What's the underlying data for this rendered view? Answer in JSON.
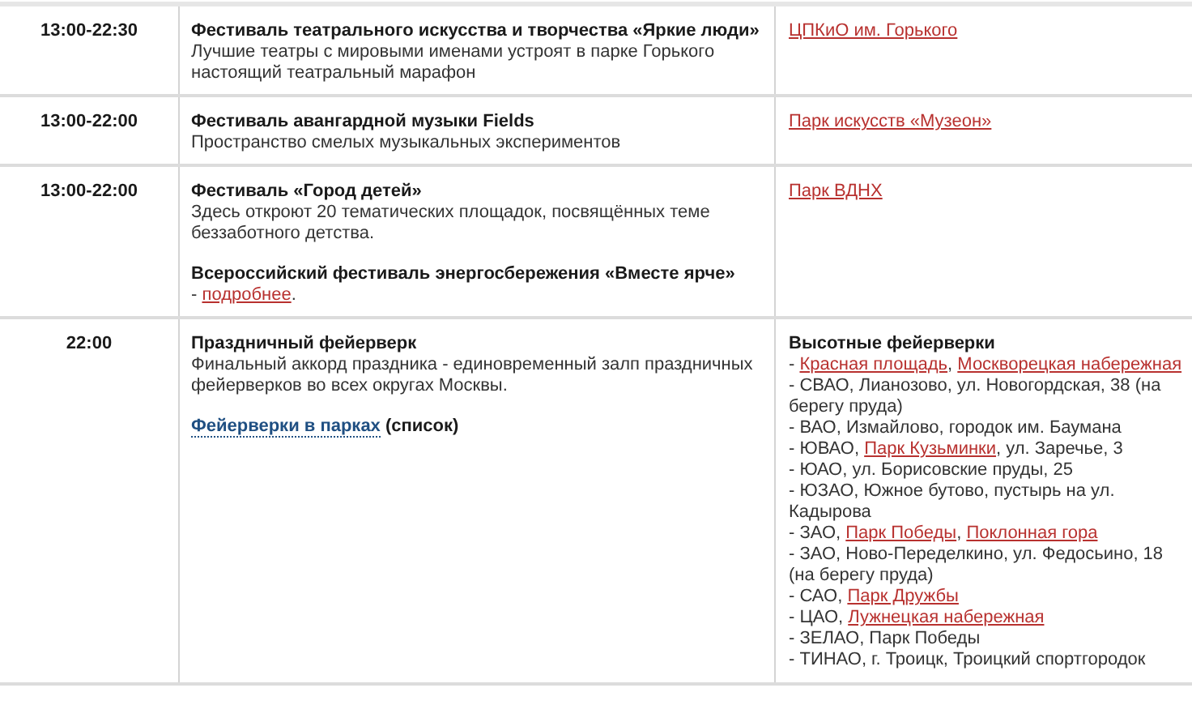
{
  "rows": [
    {
      "time": "13:00-22:30",
      "event": [
        {
          "kind": "title",
          "segments": [
            {
              "kind": "text",
              "text": "Фестиваль театрального искусства и творчества «Яркие люди»"
            }
          ]
        },
        {
          "kind": "text",
          "segments": [
            {
              "kind": "text",
              "text": "Лучшие театры с мировыми именами устроят в парке Горького настоящий театральный марафон"
            }
          ]
        }
      ],
      "place": [
        {
          "kind": "text",
          "segments": [
            {
              "kind": "link",
              "text": "ЦПКиО им. Горького"
            }
          ]
        }
      ]
    },
    {
      "time": "13:00-22:00",
      "event": [
        {
          "kind": "title",
          "segments": [
            {
              "kind": "text",
              "text": "Фестиваль авангардной музыки Fields"
            }
          ]
        },
        {
          "kind": "text",
          "segments": [
            {
              "kind": "text",
              "text": "Пространство смелых музыкальных экспериментов"
            }
          ]
        }
      ],
      "place": [
        {
          "kind": "text",
          "segments": [
            {
              "kind": "link",
              "text": "Парк искусств «Музеон»"
            }
          ]
        }
      ]
    },
    {
      "time": "13:00-22:00",
      "event": [
        {
          "kind": "title",
          "segments": [
            {
              "kind": "text",
              "text": "Фестиваль «Город детей»"
            }
          ]
        },
        {
          "kind": "text",
          "segments": [
            {
              "kind": "text",
              "text": "Здесь откроют 20 тематических площадок, посвящённых теме беззаботного детства."
            }
          ]
        },
        {
          "kind": "subtitle",
          "segments": [
            {
              "kind": "text",
              "text": "Всероссийский фестиваль энергосбережения «Вместе ярче»"
            }
          ]
        },
        {
          "kind": "text",
          "segments": [
            {
              "kind": "text",
              "text": "- "
            },
            {
              "kind": "link",
              "text": "подробнее"
            },
            {
              "kind": "text",
              "text": "."
            }
          ]
        }
      ],
      "place": [
        {
          "kind": "text",
          "segments": [
            {
              "kind": "link",
              "text": "Парк ВДНХ"
            }
          ]
        }
      ]
    },
    {
      "time": "22:00",
      "event": [
        {
          "kind": "title",
          "segments": [
            {
              "kind": "text",
              "text": "Праздничный фейерверк"
            }
          ]
        },
        {
          "kind": "text",
          "segments": [
            {
              "kind": "text",
              "text": "Финальный аккорд праздника - единовременный залп праздничных фейерверков во всех округах Москвы."
            }
          ]
        },
        {
          "kind": "subtitle",
          "segments": [
            {
              "kind": "dotted_link",
              "text": "Фейерверки в парках"
            },
            {
              "kind": "text",
              "text": " (список)"
            }
          ]
        }
      ],
      "place": [
        {
          "kind": "title",
          "segments": [
            {
              "kind": "text",
              "text": "Высотные фейерверки"
            }
          ]
        },
        {
          "kind": "text",
          "segments": [
            {
              "kind": "text",
              "text": "- "
            },
            {
              "kind": "link",
              "text": "Красная площадь"
            },
            {
              "kind": "text",
              "text": ", "
            },
            {
              "kind": "link",
              "text": "Москворецкая набережная"
            }
          ]
        },
        {
          "kind": "text",
          "segments": [
            {
              "kind": "text",
              "text": "- СВАО, Лианозово, ул. Новогордская, 38 (на берегу пруда)"
            }
          ]
        },
        {
          "kind": "text",
          "segments": [
            {
              "kind": "text",
              "text": "- ВАО, Измайлово, городок им. Баумана"
            }
          ]
        },
        {
          "kind": "text",
          "segments": [
            {
              "kind": "text",
              "text": "- ЮВАО, "
            },
            {
              "kind": "link",
              "text": "Парк Кузьминки"
            },
            {
              "kind": "text",
              "text": ", ул. Заречье, 3"
            }
          ]
        },
        {
          "kind": "text",
          "segments": [
            {
              "kind": "text",
              "text": "- ЮАО, ул. Борисовские пруды, 25"
            }
          ]
        },
        {
          "kind": "text",
          "segments": [
            {
              "kind": "text",
              "text": "- ЮЗАО, Южное бутово, пустырь на ул. Кадырова"
            }
          ]
        },
        {
          "kind": "text",
          "segments": [
            {
              "kind": "text",
              "text": "- ЗАО, "
            },
            {
              "kind": "link",
              "text": "Парк Победы"
            },
            {
              "kind": "text",
              "text": ", "
            },
            {
              "kind": "link",
              "text": "Поклонная гора"
            }
          ]
        },
        {
          "kind": "text",
          "segments": [
            {
              "kind": "text",
              "text": "- ЗАО, Ново-Переделкино, ул. Федосьино, 18 (на берегу пруда)"
            }
          ]
        },
        {
          "kind": "text",
          "segments": [
            {
              "kind": "text",
              "text": "- САО, "
            },
            {
              "kind": "link",
              "text": "Парк Дружбы"
            }
          ]
        },
        {
          "kind": "text",
          "segments": [
            {
              "kind": "text",
              "text": "- ЦАО, "
            },
            {
              "kind": "link",
              "text": "Лужнецкая набережная"
            }
          ]
        },
        {
          "kind": "text",
          "segments": [
            {
              "kind": "text",
              "text": "- ЗЕЛАО, Парк Победы"
            }
          ]
        },
        {
          "kind": "text",
          "segments": [
            {
              "kind": "text",
              "text": "- ТИНАО, г. Троицк, Троицкий спортгородок"
            }
          ]
        }
      ]
    }
  ]
}
